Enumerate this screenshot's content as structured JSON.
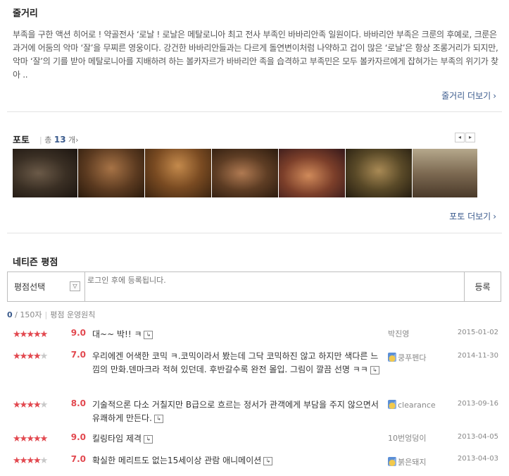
{
  "synopsis": {
    "title": "줄거리",
    "text": "부족을 구한 액션 히어로 ! 약골전사 ‘로날 ! 로날은 메탈로니아 최고 전사 부족인 바바리안족 일원이다. 바바리안 부족은 크룬의 후예로, 크룬은 과거에 어둠의 악마 ‘잘’을 무찌른 영웅이다. 강건한 바바리안들과는 다르게 돌연변이처럼 나약하고 겁이 많은 ‘로날’은 항상 조롱거리가 되지만, 악마 ‘잘’의 기를 받아 메탈로니아를 지배하려 하는 볼카자르가 바바리안 족을 습격하고 부족민은 모두 볼카자르에게 잡혀가는 부족의 위기가 찾아 ..",
    "more_label": "줄거리 더보기",
    "more_arrow": "›"
  },
  "photo": {
    "title": "포토",
    "count_prefix": "총",
    "count": "13",
    "count_suffix": "개",
    "count_arrow": "›",
    "prev_icon": "◂",
    "next_icon": "▸",
    "more_label": "포토 더보기",
    "more_arrow": "›"
  },
  "reviews": {
    "title": "네티즌 평점",
    "select_label": "평점선택",
    "select_icon": "▽",
    "input_placeholder": "로그인 후에 등록됩니다.",
    "submit_label": "등록",
    "char_current": "0",
    "char_max": "/ 150자",
    "policy_label": "평점 운영원칙",
    "reply_icon": "↳",
    "colors": {
      "star_on": "#e2484f",
      "star_off": "#c8c8c8",
      "link": "#3a5a8c"
    },
    "items": [
      {
        "stars": "★★★★★",
        "score": "9.0",
        "text": "대~~ 박!! ㅋ",
        "writer": "박진영",
        "medal": false,
        "date": "2015-01-02"
      },
      {
        "stars": "★★★★☆",
        "score": "7.0",
        "text": "우리에겐 어색한 코믹 ㅋ.코믹이라서 봤는데 그닥 코믹하진 않고 하지만 색다른 느낌의 만화.덴마크라 적혀 있던데. 후반갈수록 완전 몰입. 그림이 깔끔 선명 ㅋㅋ",
        "writer": "쿵푸펜다",
        "medal": true,
        "date": "2014-11-30"
      },
      {
        "stars": "★★★★☆",
        "score": "8.0",
        "text": "기술적으론 다소 거칠지만 B급으로 흐르는 정서가 관객에게 부담을 주지 않으면서 유쾌하게 만든다.",
        "writer": "clearance",
        "medal": true,
        "date": "2013-09-16"
      },
      {
        "stars": "★★★★★",
        "score": "9.0",
        "text": "킬링타임 제격",
        "writer": "10번엉덩이",
        "medal": false,
        "date": "2013-04-05"
      },
      {
        "stars": "★★★★☆",
        "score": "7.0",
        "text": "확실한 메리트도 없는15세이상 관람 애니메이션",
        "writer": "붉은돼지",
        "medal": true,
        "date": "2013-04-03"
      }
    ]
  }
}
